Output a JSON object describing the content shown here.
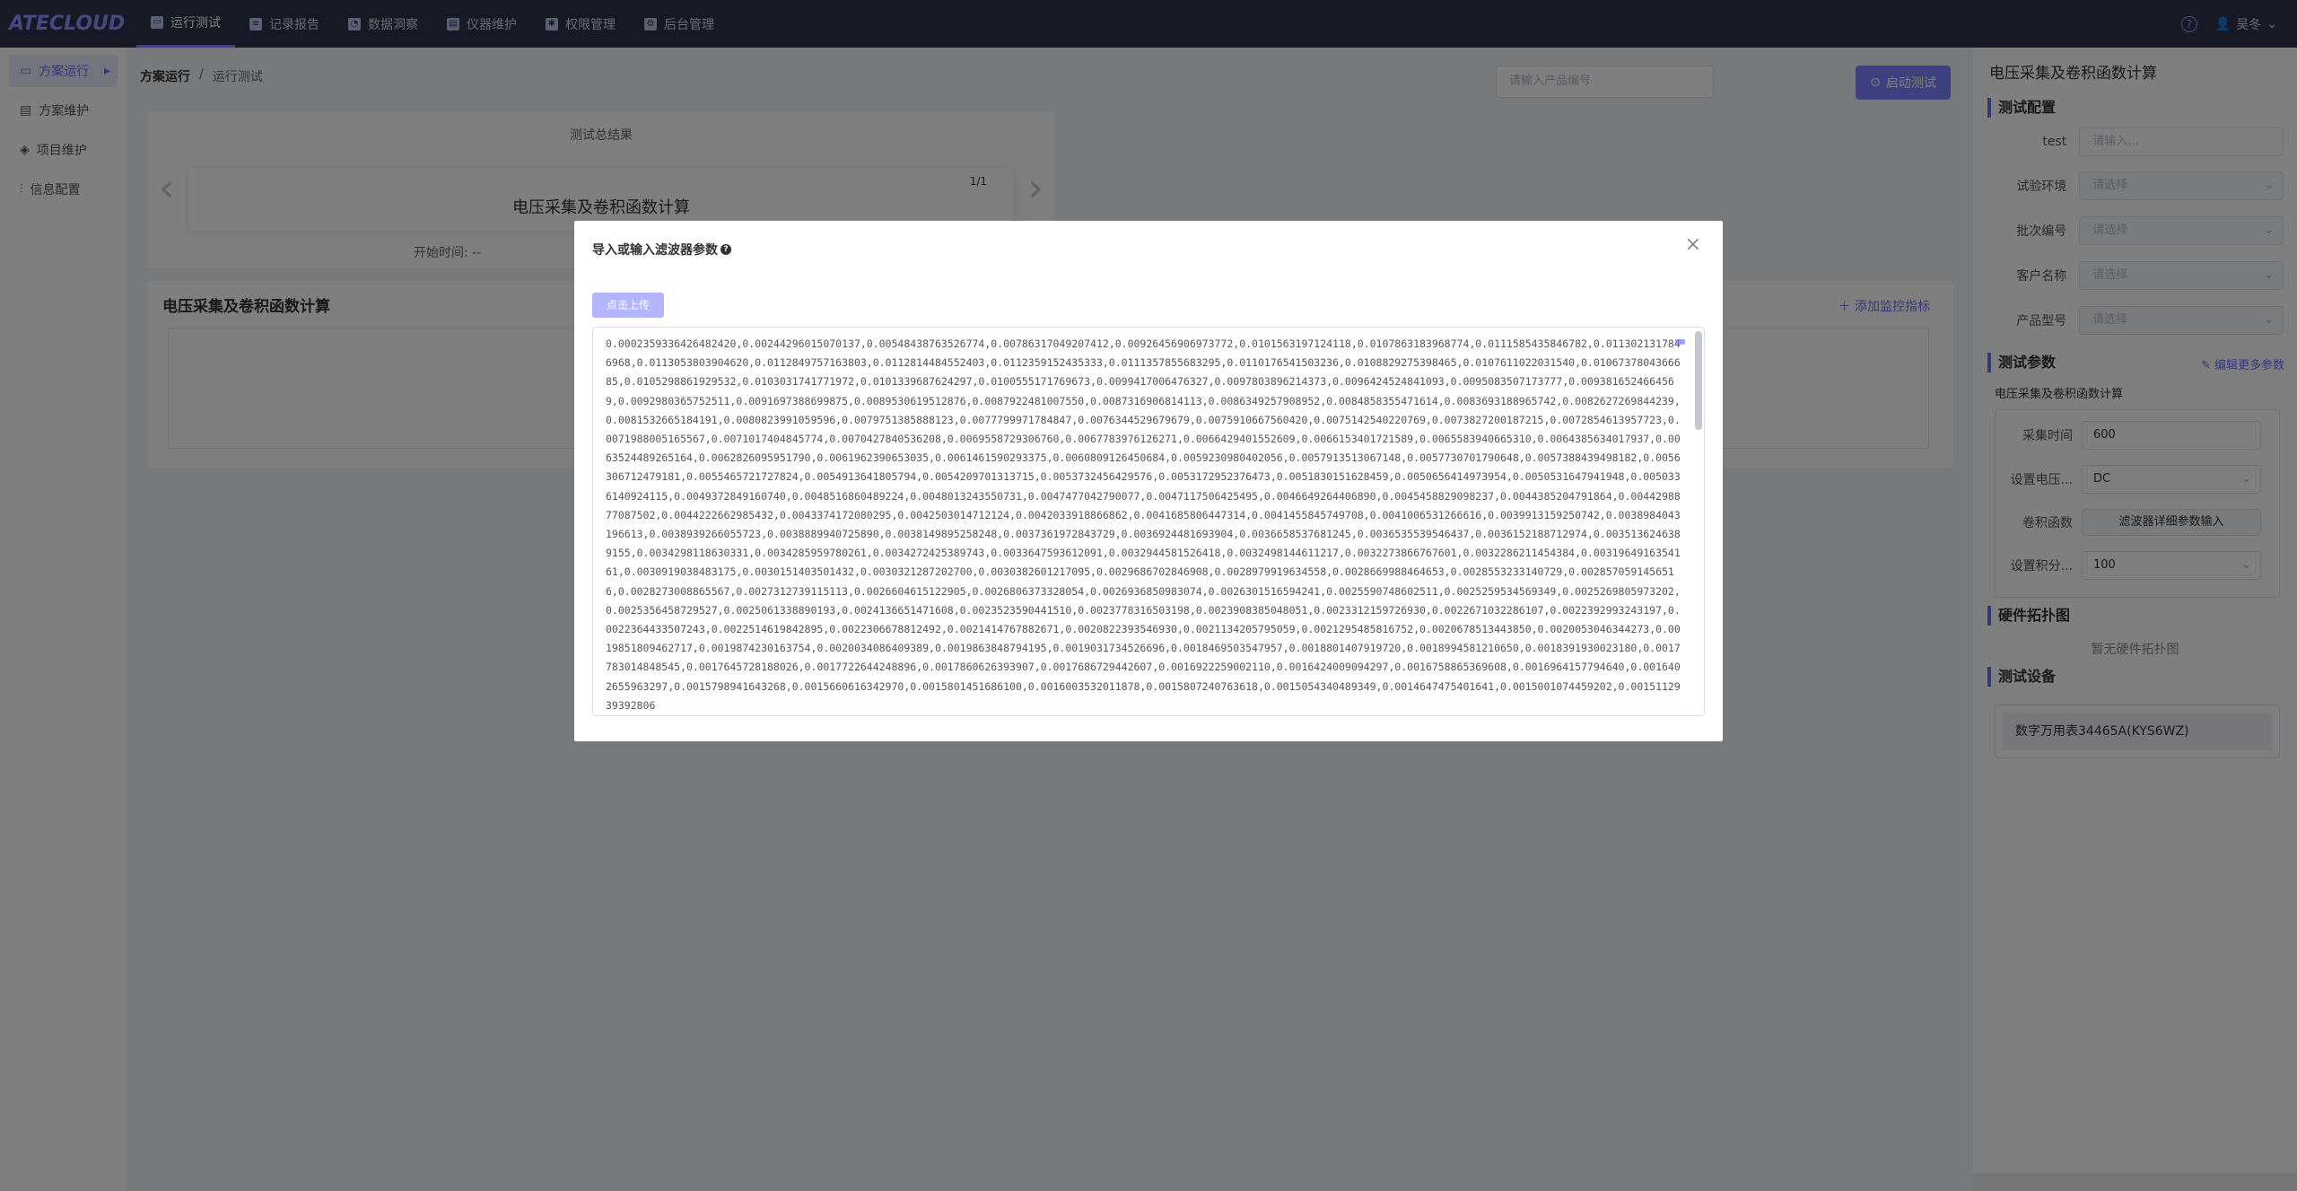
{
  "app": {
    "logo": "ATECLOUD"
  },
  "nav": [
    {
      "label": "运行测试",
      "icon": "monitor-icon",
      "active": true
    },
    {
      "label": "记录报告",
      "icon": "report-icon",
      "active": false
    },
    {
      "label": "数据洞察",
      "icon": "insight-icon",
      "active": false
    },
    {
      "label": "仪器维护",
      "icon": "instrument-icon",
      "active": false
    },
    {
      "label": "权限管理",
      "icon": "gear-icon",
      "active": false
    },
    {
      "label": "后台管理",
      "icon": "admin-icon",
      "active": false
    }
  ],
  "header": {
    "user": "吴冬"
  },
  "sidebar": {
    "items": [
      {
        "label": "方案运行",
        "active": true
      },
      {
        "label": "方案维护"
      },
      {
        "label": "项目维护"
      },
      {
        "label": "信息配置"
      }
    ]
  },
  "breadcrumb": {
    "current": "方案运行",
    "sub": "运行测试"
  },
  "product_input": {
    "placeholder": "请输入产品编号"
  },
  "start_button": {
    "label": "启动测试"
  },
  "summary": {
    "title": "测试总结果",
    "card_title": "电压采集及卷积函数计算",
    "pager": "1/1",
    "start_time": "开始时间: --"
  },
  "monitor": {
    "title": "电压采集及卷积函数计算",
    "add_label": "添加监控指标"
  },
  "right_panel": {
    "title": "电压采集及卷积函数计算",
    "config": {
      "title": "测试配置",
      "fields": [
        {
          "label": "test",
          "placeholder": "请输入...",
          "select": false
        },
        {
          "label": "试验环境",
          "placeholder": "请选择",
          "select": true
        },
        {
          "label": "批次编号",
          "placeholder": "请选择",
          "select": true
        },
        {
          "label": "客户名称",
          "placeholder": "请选择",
          "select": true
        },
        {
          "label": "产品型号",
          "placeholder": "请选择",
          "select": true
        }
      ]
    },
    "params": {
      "title": "测试参数",
      "edit_label": "编辑更多参数",
      "subtitle": "电压采集及卷积函数计算",
      "fields": [
        {
          "label": "采集时间",
          "value": "600"
        },
        {
          "label": "设置电压...",
          "value": "DC"
        },
        {
          "label": "卷积函数",
          "value": "滤波器详细参数输入"
        },
        {
          "label": "设置积分...",
          "value": "100"
        }
      ]
    },
    "topology": {
      "title": "硬件拓扑图",
      "empty": "暂无硬件拓扑图"
    },
    "devices": {
      "title": "测试设备",
      "items": [
        "数字万用表34465A(KYS6WZ)"
      ]
    }
  },
  "modal": {
    "title": "导入或输入滤波器参数",
    "upload_label": "点击上传",
    "textarea_value": "0.0002359336426482420,0.00244296015070137,0.00548438763526774,0.00786317049207412,0.00926456906973772,0.0101563197124118,0.0107863183968774,0.0111585435846782,0.0113021317846968,0.0113053803904620,0.0112849757163803,0.0112814484552403,0.0112359152435333,0.0111357855683295,0.0110176541503236,0.0108829275398465,0.0107611022031540,0.0106737804366685,0.0105298861929532,0.0103031741771972,0.0101339687624297,0.0100555171769673,0.0099417006476327,0.0097803896214373,0.0096424524841093,0.0095083507173777,0.0093816524664569,0.0092980365752511,0.0091697388699875,0.0089530619512876,0.0087922481007550,0.0087316906814113,0.0086349257908952,0.0084858355471614,0.0083693188965742,0.0082627269844239,0.0081532665184191,0.0080823991059596,0.0079751385888123,0.0077799971784847,0.0076344529679679,0.0075910667560420,0.0075142540220769,0.0073827200187215,0.0072854613957723,0.0071988005165567,0.0071017404845774,0.0070427840536208,0.0069558729306760,0.0067783976126271,0.0066429401552609,0.0066153401721589,0.0065583940665310,0.0064385634017937,0.0063524489265164,0.0062826095951790,0.0061962390653035,0.0061461590293375,0.0060809126450684,0.0059230980402056,0.0057913513067148,0.0057730701790648,0.0057388439498182,0.0056306712479181,0.0055465721727824,0.0054913641805794,0.0054209701313715,0.0053732456429576,0.0053172952376473,0.0051830151628459,0.0050656414973954,0.0050531647941948,0.0050336140924115,0.0049372849160740,0.0048516860489224,0.0048013243550731,0.0047477042790077,0.0047117506425495,0.0046649264406890,0.0045458829098237,0.0044385204791864,0.0044298877087502,0.0044222662985432,0.0043374172080295,0.0042503014712124,0.0042033918866862,0.0041685806447314,0.0041455845749708,0.0041006531266616,0.0039913159250742,0.0038984043196613,0.0038939266055723,0.0038889940725890,0.0038149895258248,0.0037361972843729,0.0036924481693904,0.0036658537681245,0.0036535539546437,0.0036152188712974,0.0035136246389155,0.0034298118630331,0.0034285959780261,0.0034272425389743,0.0033647593612091,0.0032944581526418,0.0032498144611217,0.0032273866767601,0.0032286211454384,0.0031964916354161,0.0030919038483175,0.0030151403501432,0.0030321287202700,0.0030382601217095,0.0029686702846908,0.0028979919634558,0.0028669988464653,0.0028553233140729,0.0028570591456516,0.0028273008865567,0.0027312739115113,0.0026604615122905,0.0026806373328054,0.0026936850983074,0.0026301516594241,0.0025590748602511,0.0025259534569349,0.0025269805973202,0.0025356458729527,0.0025061338890193,0.0024136651471608,0.0023523590441510,0.0023778316503198,0.0023908385048051,0.0023312159726930,0.0022671032286107,0.0022392993243197,0.0022364433507243,0.0022514619842895,0.0022306678812492,0.0021414767882671,0.0020822393546930,0.0021134205795059,0.0021295485816752,0.0020678513443850,0.0020053046344273,0.0019851809462717,0.0019874230163754,0.0020034086409389,0.0019863848794195,0.0019031734526696,0.0018469503547957,0.0018801407919720,0.0018994581210650,0.0018391930023180,0.0017783014848545,0.0017645728188026,0.0017722644248896,0.0017860626393907,0.0017686729442607,0.0016922259002110,0.0016424009094297,0.0016758865369608,0.0016964157794640,0.0016402655963297,0.0015798941643268,0.0015660616342970,0.0015801451686100,0.0016003532011878,0.0015807240763618,0.0015054340489349,0.0014647475401641,0.0015001074459202,0.0015112939392806"
  }
}
